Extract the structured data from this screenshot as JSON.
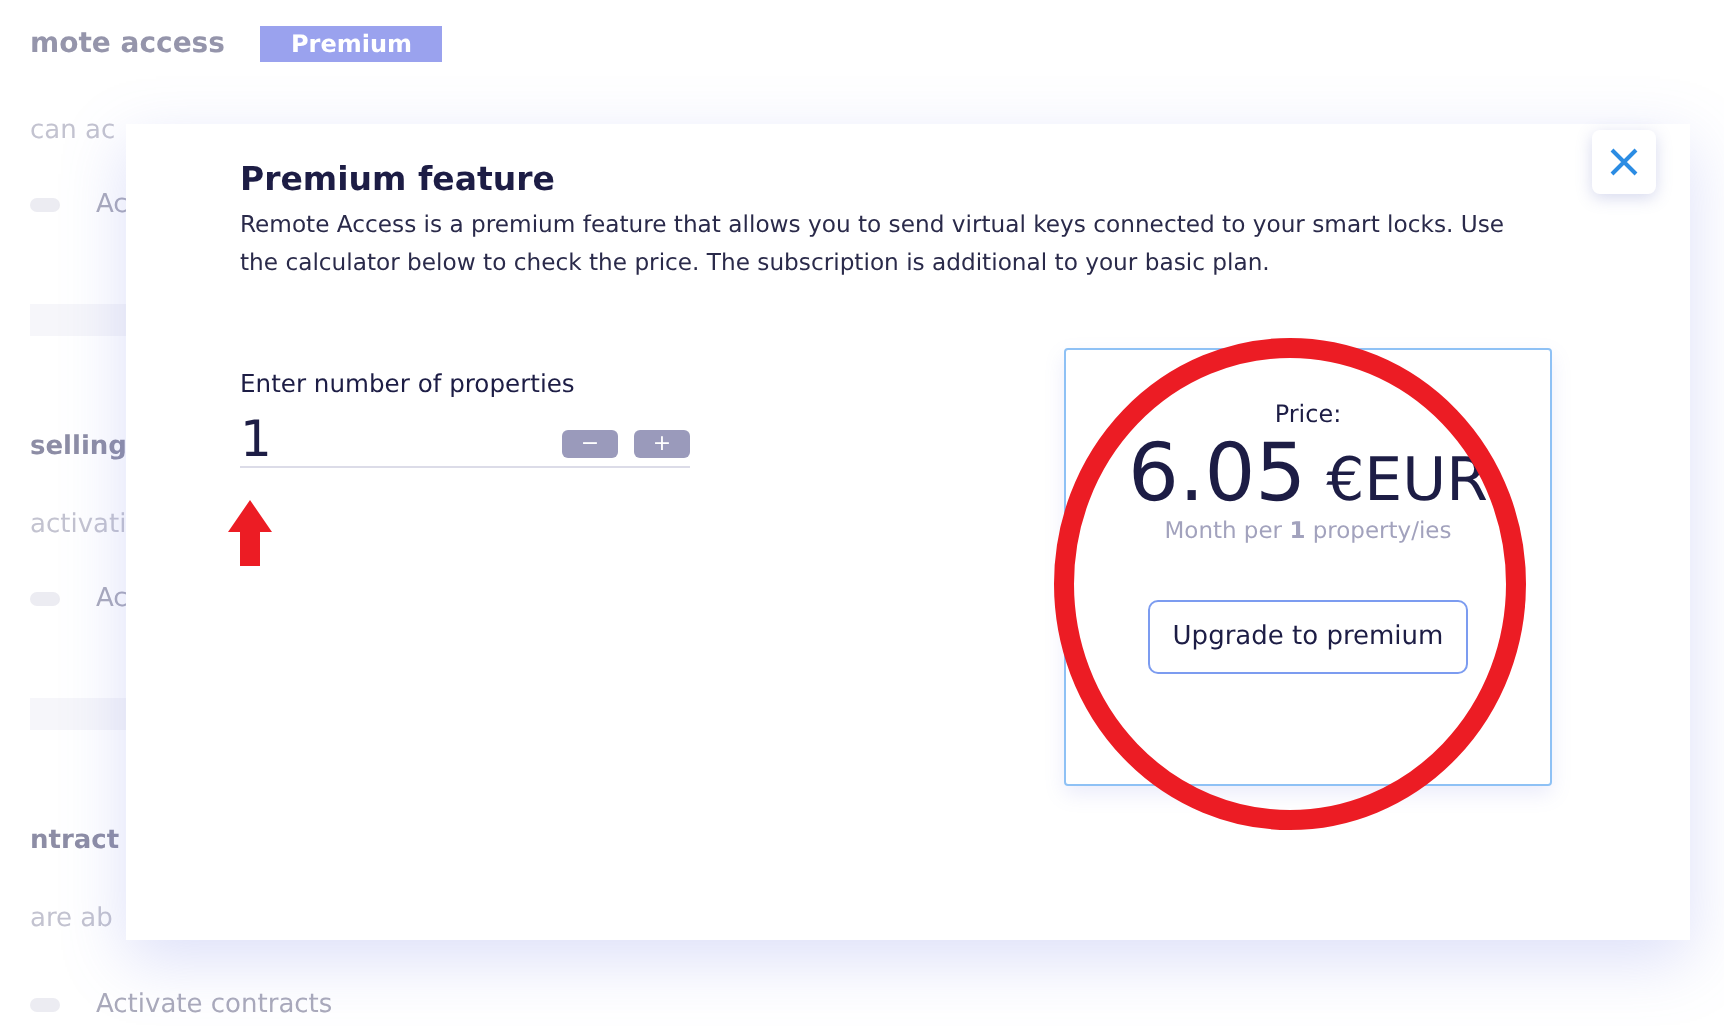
{
  "background": {
    "title": "mote access",
    "badge": "Premium",
    "sections": [
      {
        "text": "can ac",
        "toggle_on": false,
        "toggle_label": "Ac"
      },
      {
        "heading": "selling",
        "text": "activati",
        "toggle_on": false,
        "toggle_label": "Ac"
      },
      {
        "heading": "ntract",
        "text": "are ab",
        "toggle_on": false,
        "toggle_label": "Activate contracts"
      }
    ]
  },
  "modal": {
    "title": "Premium feature",
    "description": "Remote Access is a premium feature that allows you to send virtual keys connected to your smart locks. Use the calculator below to check the price. The subscription is additional to your basic plan.",
    "calculator": {
      "label": "Enter number of properties",
      "value": "1",
      "buttons": [
        "−",
        "+"
      ]
    },
    "price": {
      "label": "Price:",
      "amount": "6.05",
      "currency": "€EUR",
      "note": "Month per **1** property/ies",
      "button": "Upgrade to premium"
    }
  }
}
